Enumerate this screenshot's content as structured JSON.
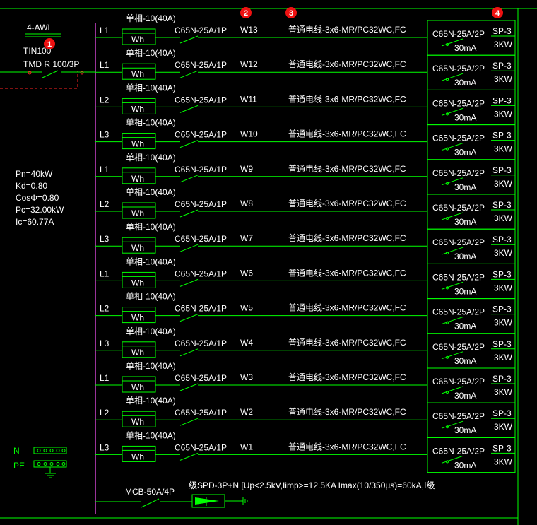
{
  "panel": {
    "name": "4-AWL",
    "model": "TIN100",
    "main_breaker": "TMD R 100/3P"
  },
  "load_params": [
    "Pn=40kW",
    "Kd=0.80",
    "CosΦ=0.80",
    "Pc=32.00kW",
    "Ic=60.77A"
  ],
  "bus_labels": {
    "n": "N",
    "pe": "PE"
  },
  "markers": [
    "1",
    "2",
    "3",
    "4"
  ],
  "meter_label": "Wh",
  "meter_spec": "单相-10(40A)",
  "circuits": [
    {
      "phase": "L1",
      "breaker": "C65N-25A/1P",
      "id": "W13",
      "cable": "普通电线-3x6-MR/PC32WC,FC",
      "rcd": "C65N-25A/2P",
      "rcd_ma": "30mA",
      "socket": "SP-3",
      "power": "3KW"
    },
    {
      "phase": "L1",
      "breaker": "C65N-25A/1P",
      "id": "W12",
      "cable": "普通电线-3x6-MR/PC32WC,FC",
      "rcd": "C65N-25A/2P",
      "rcd_ma": "30mA",
      "socket": "SP-3",
      "power": "3KW"
    },
    {
      "phase": "L2",
      "breaker": "C65N-25A/1P",
      "id": "W11",
      "cable": "普通电线-3x6-MR/PC32WC,FC",
      "rcd": "C65N-25A/2P",
      "rcd_ma": "30mA",
      "socket": "SP-3",
      "power": "3KW"
    },
    {
      "phase": "L3",
      "breaker": "C65N-25A/1P",
      "id": "W10",
      "cable": "普通电线-3x6-MR/PC32WC,FC",
      "rcd": "C65N-25A/2P",
      "rcd_ma": "30mA",
      "socket": "SP-3",
      "power": "3KW"
    },
    {
      "phase": "L1",
      "breaker": "C65N-25A/1P",
      "id": "W9",
      "cable": "普通电线-3x6-MR/PC32WC,FC",
      "rcd": "C65N-25A/2P",
      "rcd_ma": "30mA",
      "socket": "SP-3",
      "power": "3KW"
    },
    {
      "phase": "L2",
      "breaker": "C65N-25A/1P",
      "id": "W8",
      "cable": "普通电线-3x6-MR/PC32WC,FC",
      "rcd": "C65N-25A/2P",
      "rcd_ma": "30mA",
      "socket": "SP-3",
      "power": "3KW"
    },
    {
      "phase": "L3",
      "breaker": "C65N-25A/1P",
      "id": "W7",
      "cable": "普通电线-3x6-MR/PC32WC,FC",
      "rcd": "C65N-25A/2P",
      "rcd_ma": "30mA",
      "socket": "SP-3",
      "power": "3KW"
    },
    {
      "phase": "L1",
      "breaker": "C65N-25A/1P",
      "id": "W6",
      "cable": "普通电线-3x6-MR/PC32WC,FC",
      "rcd": "C65N-25A/2P",
      "rcd_ma": "30mA",
      "socket": "SP-3",
      "power": "3KW"
    },
    {
      "phase": "L2",
      "breaker": "C65N-25A/1P",
      "id": "W5",
      "cable": "普通电线-3x6-MR/PC32WC,FC",
      "rcd": "C65N-25A/2P",
      "rcd_ma": "30mA",
      "socket": "SP-3",
      "power": "3KW"
    },
    {
      "phase": "L3",
      "breaker": "C65N-25A/1P",
      "id": "W4",
      "cable": "普通电线-3x6-MR/PC32WC,FC",
      "rcd": "C65N-25A/2P",
      "rcd_ma": "30mA",
      "socket": "SP-3",
      "power": "3KW"
    },
    {
      "phase": "L1",
      "breaker": "C65N-25A/1P",
      "id": "W3",
      "cable": "普通电线-3x6-MR/PC32WC,FC",
      "rcd": "C65N-25A/2P",
      "rcd_ma": "30mA",
      "socket": "SP-3",
      "power": "3KW"
    },
    {
      "phase": "L2",
      "breaker": "C65N-25A/1P",
      "id": "W2",
      "cable": "普通电线-3x6-MR/PC32WC,FC",
      "rcd": "C65N-25A/2P",
      "rcd_ma": "30mA",
      "socket": "SP-3",
      "power": "3KW"
    },
    {
      "phase": "L3",
      "breaker": "C65N-25A/1P",
      "id": "W1",
      "cable": "普通电线-3x6-MR/PC32WC,FC",
      "rcd": "C65N-25A/2P",
      "rcd_ma": "30mA",
      "socket": "SP-3",
      "power": "3KW"
    }
  ],
  "spd": {
    "breaker": "MCB-50A/4P",
    "description": "一级SPD-3P+N [Up<2.5kV,Iimp>=12.5KA Imax(10/350μs)=60kA,Ⅰ级"
  },
  "colors": {
    "background": "#000000",
    "wire": "#00ff00",
    "bus": "#cc44cc",
    "dashed": "#ff2222",
    "marker": "#ee1111",
    "text": "#ffffff"
  }
}
